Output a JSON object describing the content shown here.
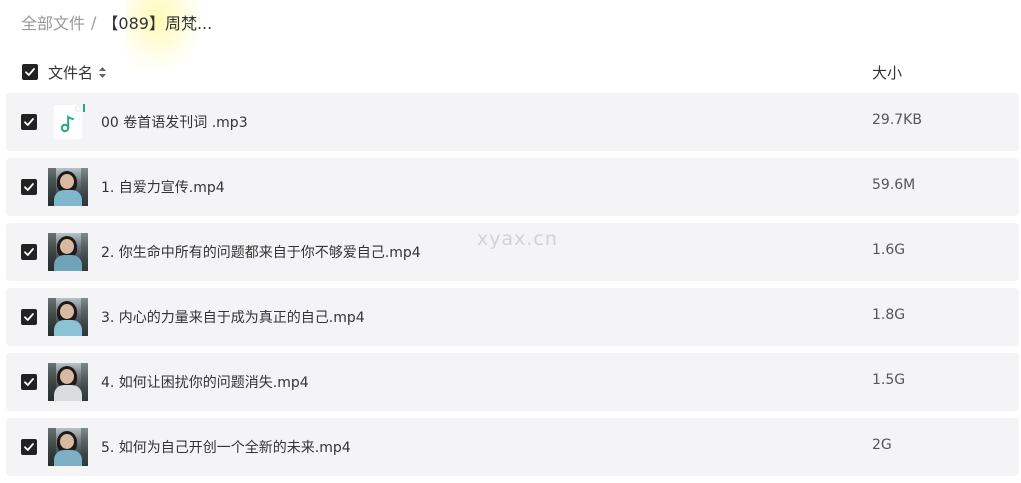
{
  "breadcrumb": {
    "root": "全部文件",
    "separator": "/",
    "current": "【089】周梵..."
  },
  "header": {
    "name_label": "文件名",
    "size_label": "大小",
    "sort_icon": "sort-up-down-icon"
  },
  "files": [
    {
      "name": "00 卷首语发刊词 .mp3",
      "size": "29.7KB",
      "type": "audio",
      "icon": "music-note-icon",
      "checked": true
    },
    {
      "name": "1. 自爱力宣传.mp4",
      "size": "59.6M",
      "type": "video",
      "checked": true
    },
    {
      "name": "2. 你生命中所有的问题都来自于你不够爱自己.mp4",
      "size": "1.6G",
      "type": "video",
      "checked": true
    },
    {
      "name": "3. 内心的力量来自于成为真正的自己.mp4",
      "size": "1.8G",
      "type": "video",
      "checked": true
    },
    {
      "name": "4. 如何让困扰你的问题消失.mp4",
      "size": "1.5G",
      "type": "video",
      "checked": true
    },
    {
      "name": "5. 如何为自己开创一个全新的未来.mp4",
      "size": "2G",
      "type": "video",
      "checked": true
    }
  ],
  "watermark": "xyax.cn",
  "colors": {
    "checkbox": "#222222",
    "row_bg": "#f4f4f6",
    "audio_icon": "#1fae7a"
  }
}
